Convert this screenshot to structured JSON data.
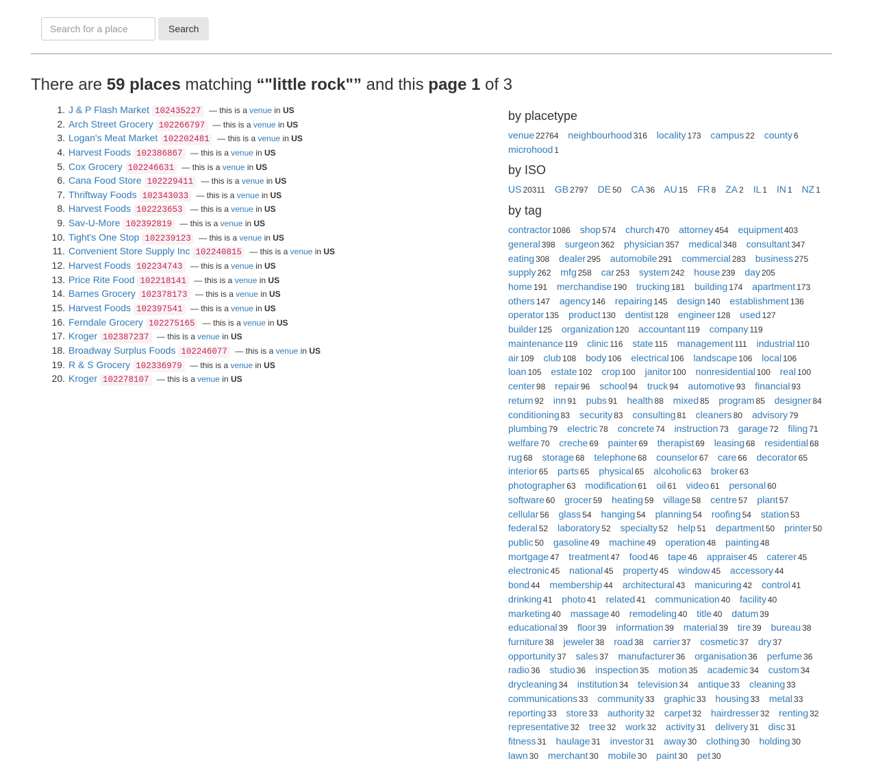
{
  "search": {
    "placeholder": "Search for a place",
    "button_label": "Search"
  },
  "heading": {
    "prefix": "There are ",
    "count": "59 places",
    "mid": " matching ",
    "query": "“\"little rock\"”",
    "mid2": " and this ",
    "page": "page 1",
    "suffix": " of 3"
  },
  "results": [
    {
      "name": "J & P Flash Market",
      "id": "102435227",
      "placetype": "venue",
      "country": "US"
    },
    {
      "name": "Arch Street Grocery",
      "id": "102266797",
      "placetype": "venue",
      "country": "US"
    },
    {
      "name": "Logan's Meat Market",
      "id": "102202481",
      "placetype": "venue",
      "country": "US"
    },
    {
      "name": "Harvest Foods",
      "id": "102386867",
      "placetype": "venue",
      "country": "US"
    },
    {
      "name": "Cox Grocery",
      "id": "102246631",
      "placetype": "venue",
      "country": "US"
    },
    {
      "name": "Cana Food Store",
      "id": "102229411",
      "placetype": "venue",
      "country": "US"
    },
    {
      "name": "Thriftway Foods",
      "id": "102343033",
      "placetype": "venue",
      "country": "US"
    },
    {
      "name": "Harvest Foods",
      "id": "102223653",
      "placetype": "venue",
      "country": "US"
    },
    {
      "name": "Sav-U-More",
      "id": "102392819",
      "placetype": "venue",
      "country": "US"
    },
    {
      "name": "Tight's One Stop",
      "id": "102239123",
      "placetype": "venue",
      "country": "US"
    },
    {
      "name": "Convenient Store Supply Inc",
      "id": "102240815",
      "placetype": "venue",
      "country": "US"
    },
    {
      "name": "Harvest Foods",
      "id": "102234743",
      "placetype": "venue",
      "country": "US"
    },
    {
      "name": "Price Rite Food",
      "id": "102218141",
      "placetype": "venue",
      "country": "US"
    },
    {
      "name": "Barnes Grocery",
      "id": "102378173",
      "placetype": "venue",
      "country": "US"
    },
    {
      "name": "Harvest Foods",
      "id": "102397541",
      "placetype": "venue",
      "country": "US"
    },
    {
      "name": "Ferndale Grocery",
      "id": "102275165",
      "placetype": "venue",
      "country": "US"
    },
    {
      "name": "Kroger",
      "id": "102387237",
      "placetype": "venue",
      "country": "US"
    },
    {
      "name": "Broadway Surplus Foods",
      "id": "102246077",
      "placetype": "venue",
      "country": "US"
    },
    {
      "name": "R & S Grocery",
      "id": "102336979",
      "placetype": "venue",
      "country": "US"
    },
    {
      "name": "Kroger",
      "id": "102278107",
      "placetype": "venue",
      "country": "US"
    }
  ],
  "result_text": {
    "prefix": " — this is a ",
    "mid": " in "
  },
  "facets": [
    {
      "title": "by placetype",
      "items": [
        [
          "venue",
          "22764"
        ],
        [
          "neighbourhood",
          "316"
        ],
        [
          "locality",
          "173"
        ],
        [
          "campus",
          "22"
        ],
        [
          "county",
          "6"
        ],
        [
          "microhood",
          "1"
        ]
      ]
    },
    {
      "title": "by ISO",
      "items": [
        [
          "US",
          "20311"
        ],
        [
          "GB",
          "2797"
        ],
        [
          "DE",
          "50"
        ],
        [
          "CA",
          "36"
        ],
        [
          "AU",
          "15"
        ],
        [
          "FR",
          "8"
        ],
        [
          "ZA",
          "2"
        ],
        [
          "IL",
          "1"
        ],
        [
          "IN",
          "1"
        ],
        [
          "NZ",
          "1"
        ]
      ]
    },
    {
      "title": "by tag",
      "items": [
        [
          "contractor",
          "1086"
        ],
        [
          "shop",
          "574"
        ],
        [
          "church",
          "470"
        ],
        [
          "attorney",
          "454"
        ],
        [
          "equipment",
          "403"
        ],
        [
          "general",
          "398"
        ],
        [
          "surgeon",
          "362"
        ],
        [
          "physician",
          "357"
        ],
        [
          "medical",
          "348"
        ],
        [
          "consultant",
          "347"
        ],
        [
          "eating",
          "308"
        ],
        [
          "dealer",
          "295"
        ],
        [
          "automobile",
          "291"
        ],
        [
          "commercial",
          "283"
        ],
        [
          "business",
          "275"
        ],
        [
          "supply",
          "262"
        ],
        [
          "mfg",
          "258"
        ],
        [
          "car",
          "253"
        ],
        [
          "system",
          "242"
        ],
        [
          "house",
          "239"
        ],
        [
          "day",
          "205"
        ],
        [
          "home",
          "191"
        ],
        [
          "merchandise",
          "190"
        ],
        [
          "trucking",
          "181"
        ],
        [
          "building",
          "174"
        ],
        [
          "apartment",
          "173"
        ],
        [
          "others",
          "147"
        ],
        [
          "agency",
          "146"
        ],
        [
          "repairing",
          "145"
        ],
        [
          "design",
          "140"
        ],
        [
          "establishment",
          "136"
        ],
        [
          "operator",
          "135"
        ],
        [
          "product",
          "130"
        ],
        [
          "dentist",
          "128"
        ],
        [
          "engineer",
          "128"
        ],
        [
          "used",
          "127"
        ],
        [
          "builder",
          "125"
        ],
        [
          "organization",
          "120"
        ],
        [
          "accountant",
          "119"
        ],
        [
          "company",
          "119"
        ],
        [
          "maintenance",
          "119"
        ],
        [
          "clinic",
          "116"
        ],
        [
          "state",
          "115"
        ],
        [
          "management",
          "111"
        ],
        [
          "industrial",
          "110"
        ],
        [
          "air",
          "109"
        ],
        [
          "club",
          "108"
        ],
        [
          "body",
          "106"
        ],
        [
          "electrical",
          "106"
        ],
        [
          "landscape",
          "106"
        ],
        [
          "local",
          "106"
        ],
        [
          "loan",
          "105"
        ],
        [
          "estate",
          "102"
        ],
        [
          "crop",
          "100"
        ],
        [
          "janitor",
          "100"
        ],
        [
          "nonresidential",
          "100"
        ],
        [
          "real",
          "100"
        ],
        [
          "center",
          "98"
        ],
        [
          "repair",
          "96"
        ],
        [
          "school",
          "94"
        ],
        [
          "truck",
          "94"
        ],
        [
          "automotive",
          "93"
        ],
        [
          "financial",
          "93"
        ],
        [
          "return",
          "92"
        ],
        [
          "inn",
          "91"
        ],
        [
          "pubs",
          "91"
        ],
        [
          "health",
          "88"
        ],
        [
          "mixed",
          "85"
        ],
        [
          "program",
          "85"
        ],
        [
          "designer",
          "84"
        ],
        [
          "conditioning",
          "83"
        ],
        [
          "security",
          "83"
        ],
        [
          "consulting",
          "81"
        ],
        [
          "cleaners",
          "80"
        ],
        [
          "advisory",
          "79"
        ],
        [
          "plumbing",
          "79"
        ],
        [
          "electric",
          "78"
        ],
        [
          "concrete",
          "74"
        ],
        [
          "instruction",
          "73"
        ],
        [
          "garage",
          "72"
        ],
        [
          "filing",
          "71"
        ],
        [
          "welfare",
          "70"
        ],
        [
          "creche",
          "69"
        ],
        [
          "painter",
          "69"
        ],
        [
          "therapist",
          "69"
        ],
        [
          "leasing",
          "68"
        ],
        [
          "residential",
          "68"
        ],
        [
          "rug",
          "68"
        ],
        [
          "storage",
          "68"
        ],
        [
          "telephone",
          "68"
        ],
        [
          "counselor",
          "67"
        ],
        [
          "care",
          "66"
        ],
        [
          "decorator",
          "65"
        ],
        [
          "interior",
          "65"
        ],
        [
          "parts",
          "65"
        ],
        [
          "physical",
          "65"
        ],
        [
          "alcoholic",
          "63"
        ],
        [
          "broker",
          "63"
        ],
        [
          "photographer",
          "63"
        ],
        [
          "modification",
          "61"
        ],
        [
          "oil",
          "61"
        ],
        [
          "video",
          "61"
        ],
        [
          "personal",
          "60"
        ],
        [
          "software",
          "60"
        ],
        [
          "grocer",
          "59"
        ],
        [
          "heating",
          "59"
        ],
        [
          "village",
          "58"
        ],
        [
          "centre",
          "57"
        ],
        [
          "plant",
          "57"
        ],
        [
          "cellular",
          "56"
        ],
        [
          "glass",
          "54"
        ],
        [
          "hanging",
          "54"
        ],
        [
          "planning",
          "54"
        ],
        [
          "roofing",
          "54"
        ],
        [
          "station",
          "53"
        ],
        [
          "federal",
          "52"
        ],
        [
          "laboratory",
          "52"
        ],
        [
          "specialty",
          "52"
        ],
        [
          "help",
          "51"
        ],
        [
          "department",
          "50"
        ],
        [
          "printer",
          "50"
        ],
        [
          "public",
          "50"
        ],
        [
          "gasoline",
          "49"
        ],
        [
          "machine",
          "49"
        ],
        [
          "operation",
          "48"
        ],
        [
          "painting",
          "48"
        ],
        [
          "mortgage",
          "47"
        ],
        [
          "treatment",
          "47"
        ],
        [
          "food",
          "46"
        ],
        [
          "tape",
          "46"
        ],
        [
          "appraiser",
          "45"
        ],
        [
          "caterer",
          "45"
        ],
        [
          "electronic",
          "45"
        ],
        [
          "national",
          "45"
        ],
        [
          "property",
          "45"
        ],
        [
          "window",
          "45"
        ],
        [
          "accessory",
          "44"
        ],
        [
          "bond",
          "44"
        ],
        [
          "membership",
          "44"
        ],
        [
          "architectural",
          "43"
        ],
        [
          "manicuring",
          "42"
        ],
        [
          "control",
          "41"
        ],
        [
          "drinking",
          "41"
        ],
        [
          "photo",
          "41"
        ],
        [
          "related",
          "41"
        ],
        [
          "communication",
          "40"
        ],
        [
          "facility",
          "40"
        ],
        [
          "marketing",
          "40"
        ],
        [
          "massage",
          "40"
        ],
        [
          "remodeling",
          "40"
        ],
        [
          "title",
          "40"
        ],
        [
          "datum",
          "39"
        ],
        [
          "educational",
          "39"
        ],
        [
          "floor",
          "39"
        ],
        [
          "information",
          "39"
        ],
        [
          "material",
          "39"
        ],
        [
          "tire",
          "39"
        ],
        [
          "bureau",
          "38"
        ],
        [
          "furniture",
          "38"
        ],
        [
          "jeweler",
          "38"
        ],
        [
          "road",
          "38"
        ],
        [
          "carrier",
          "37"
        ],
        [
          "cosmetic",
          "37"
        ],
        [
          "dry",
          "37"
        ],
        [
          "opportunity",
          "37"
        ],
        [
          "sales",
          "37"
        ],
        [
          "manufacturer",
          "36"
        ],
        [
          "organisation",
          "36"
        ],
        [
          "perfume",
          "36"
        ],
        [
          "radio",
          "36"
        ],
        [
          "studio",
          "36"
        ],
        [
          "inspection",
          "35"
        ],
        [
          "motion",
          "35"
        ],
        [
          "academic",
          "34"
        ],
        [
          "custom",
          "34"
        ],
        [
          "drycleaning",
          "34"
        ],
        [
          "institution",
          "34"
        ],
        [
          "television",
          "34"
        ],
        [
          "antique",
          "33"
        ],
        [
          "cleaning",
          "33"
        ],
        [
          "communications",
          "33"
        ],
        [
          "community",
          "33"
        ],
        [
          "graphic",
          "33"
        ],
        [
          "housing",
          "33"
        ],
        [
          "metal",
          "33"
        ],
        [
          "reporting",
          "33"
        ],
        [
          "store",
          "33"
        ],
        [
          "authority",
          "32"
        ],
        [
          "carpet",
          "32"
        ],
        [
          "hairdresser",
          "32"
        ],
        [
          "renting",
          "32"
        ],
        [
          "representative",
          "32"
        ],
        [
          "tree",
          "32"
        ],
        [
          "work",
          "32"
        ],
        [
          "activity",
          "31"
        ],
        [
          "delivery",
          "31"
        ],
        [
          "disc",
          "31"
        ],
        [
          "fitness",
          "31"
        ],
        [
          "haulage",
          "31"
        ],
        [
          "investor",
          "31"
        ],
        [
          "away",
          "30"
        ],
        [
          "clothing",
          "30"
        ],
        [
          "holding",
          "30"
        ],
        [
          "lawn",
          "30"
        ],
        [
          "merchant",
          "30"
        ],
        [
          "mobile",
          "30"
        ],
        [
          "paint",
          "30"
        ],
        [
          "pet",
          "30"
        ]
      ]
    }
  ]
}
